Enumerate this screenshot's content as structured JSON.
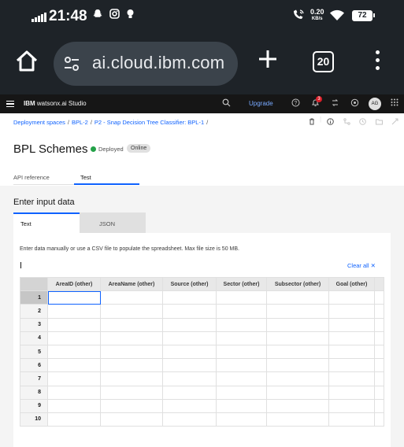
{
  "status_bar": {
    "time": "21:48",
    "net_speed": "0.20",
    "net_unit": "KB/s",
    "battery": "72"
  },
  "browser": {
    "url": "ai.cloud.ibm.com",
    "tab_count": "20"
  },
  "app_header": {
    "brand_bold": "IBM",
    "brand_rest": "watsonx.ai Studio",
    "upgrade_label": "Upgrade",
    "notification_count": "3",
    "avatar_initials": "AG"
  },
  "breadcrumb": [
    "Deployment spaces",
    "BPL-2",
    "P2 - Snap Decision Tree Classifier: BPL-1"
  ],
  "deployment": {
    "title": "BPL Schemes",
    "status": "Deployed",
    "tag": "Online"
  },
  "page_tabs": {
    "api_reference": "API reference",
    "test": "Test"
  },
  "input_section": {
    "title": "Enter input data",
    "tab_text": "Text",
    "tab_json": "JSON",
    "helper": "Enter data manually or use a CSV file to populate the spreadsheet. Max file size is 50 MB.",
    "clear_all": "Clear all"
  },
  "grid": {
    "columns": [
      "AreaID (other)",
      "AreaName (other)",
      "Source (other)",
      "Sector (other)",
      "Subsector (other)",
      "Goal (other)"
    ],
    "rows": [
      "1",
      "2",
      "3",
      "4",
      "5",
      "6",
      "7",
      "8",
      "9",
      "10"
    ]
  },
  "colors": {
    "accent": "#0f62fe",
    "status_green": "#24a148",
    "header_bg": "#161616",
    "browser_bg": "#1e2328"
  }
}
